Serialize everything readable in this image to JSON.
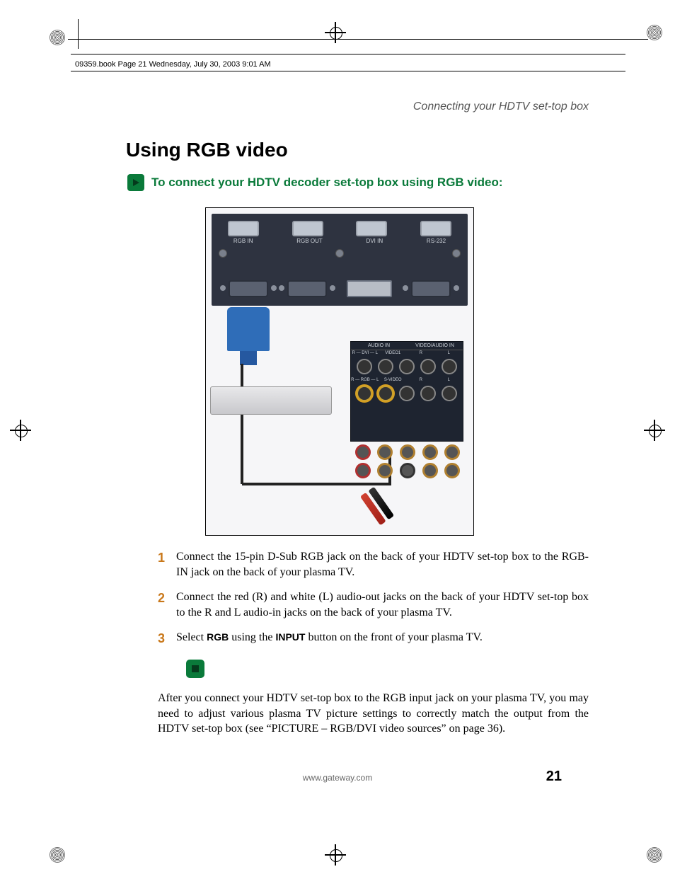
{
  "runhead": "09359.book  Page 21  Wednesday, July 30, 2003  9:01 AM",
  "section": "Connecting your HDTV set-top box",
  "h1": "Using RGB video",
  "subhead": "To connect your HDTV decoder set-top box using RGB video:",
  "diagram": {
    "top_ports": [
      "RGB IN",
      "RGB OUT",
      "DVI IN",
      "RS-232"
    ],
    "av_headers": [
      "AUDIO IN",
      "VIDEO/AUDIO IN"
    ],
    "av_sub_top": [
      "R — DVI — L",
      "VIDEO1",
      "R",
      "L"
    ],
    "av_sub_bot": [
      "R — RGB — L",
      "S-VIDEO",
      "R",
      "L"
    ]
  },
  "steps": [
    {
      "n": "1",
      "text": "Connect the 15-pin D-Sub RGB jack on the back of your HDTV set-top box to the RGB-IN jack on the back of your plasma TV."
    },
    {
      "n": "2",
      "text": "Connect the red (R) and white (L) audio-out jacks on the back of your HDTV set-top box to the R and L audio-in jacks on the back of your plasma TV."
    },
    {
      "n": "3",
      "pre": "Select ",
      "b1": "RGB",
      "mid": " using the ",
      "b2": "INPUT",
      "post": " button on the front of your plasma TV."
    }
  ],
  "after": "After you connect your HDTV set-top box to the RGB input jack on your plasma TV, you may need to adjust various plasma TV picture settings to correctly match the output from the HDTV set-top box (see “PICTURE – RGB/DVI video sources” on page 36).",
  "footer_url": "www.gateway.com",
  "page_number": "21"
}
